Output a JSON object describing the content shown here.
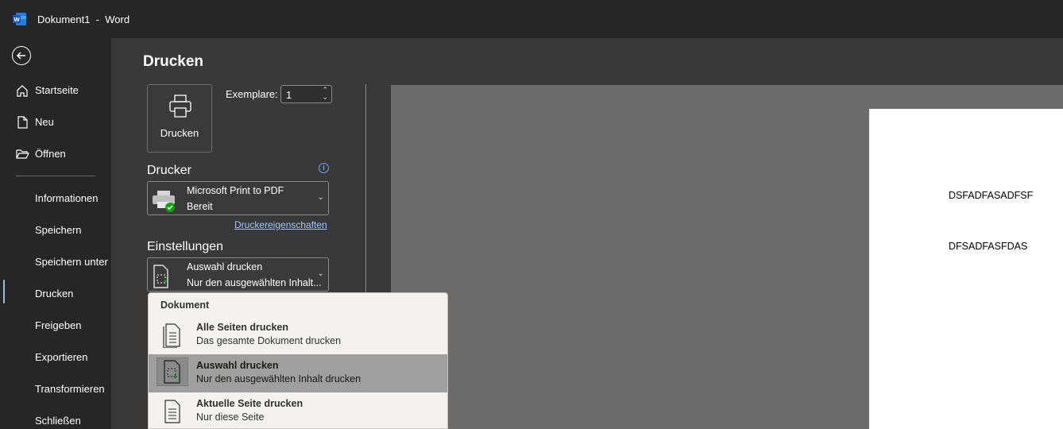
{
  "window": {
    "title": "Dokument1  -  Word",
    "accent": "#185abd"
  },
  "nav": {
    "items": [
      {
        "label": "Startseite",
        "icon": "home-icon"
      },
      {
        "label": "Neu",
        "icon": "new-document-icon"
      },
      {
        "label": "Öffnen",
        "icon": "folder-open-icon"
      },
      {
        "label": "Informationen"
      },
      {
        "label": "Speichern"
      },
      {
        "label": "Speichern unter"
      },
      {
        "label": "Drucken",
        "active": true
      },
      {
        "label": "Freigeben"
      },
      {
        "label": "Exportieren"
      },
      {
        "label": "Transformieren"
      },
      {
        "label": "Schließen"
      }
    ]
  },
  "print": {
    "heading": "Drucken",
    "print_button": "Drucken",
    "copies_label": "Exemplare:",
    "copies_value": "1",
    "printer_section": "Drucker",
    "printer_name": "Microsoft Print to PDF",
    "printer_status": "Bereit",
    "printer_properties": "Druckereigenschaften",
    "settings_section": "Einstellungen",
    "settings_selected_title": "Auswahl drucken",
    "settings_selected_sub": "Nur den ausgewählten Inhalt..."
  },
  "popup": {
    "header": "Dokument",
    "options": [
      {
        "title": "Alle Seiten drucken",
        "sub": "Das gesamte Dokument drucken",
        "icon": "all-pages-icon"
      },
      {
        "title": "Auswahl drucken",
        "sub": "Nur den ausgewählten Inhalt drucken",
        "icon": "selection-icon",
        "selected": true
      },
      {
        "title": "Aktuelle Seite drucken",
        "sub": "Nur diese Seite",
        "icon": "current-page-icon"
      }
    ]
  },
  "preview": {
    "lines": [
      "DSFADFASADFSF",
      "DFSADFASFDAS"
    ]
  }
}
